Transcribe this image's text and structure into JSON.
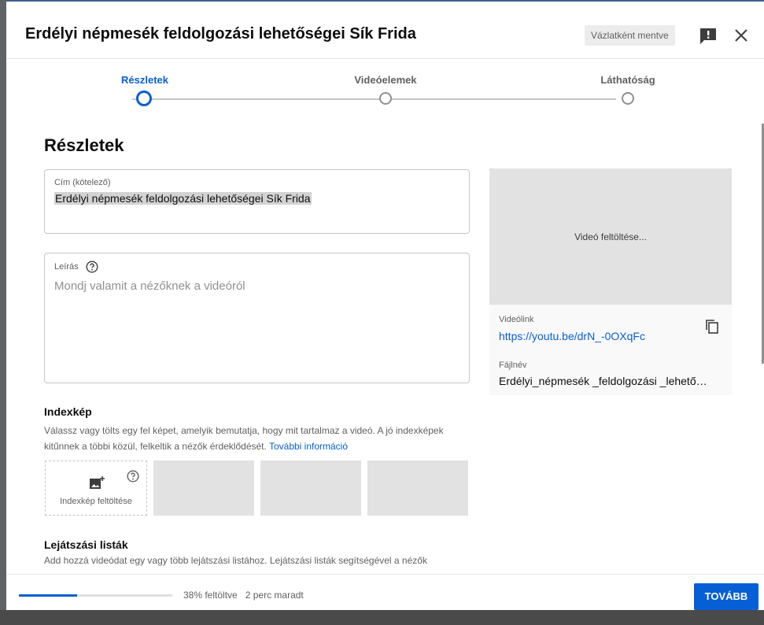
{
  "dialog": {
    "title": "Erdélyi népmesék feldolgozási lehetőségei Sík Frida",
    "draft_badge": "Vázlatként mentve"
  },
  "stepper": {
    "steps": [
      {
        "label": "Részletek",
        "active": true
      },
      {
        "label": "Videóelemek",
        "active": false
      },
      {
        "label": "Láthatóság",
        "active": false
      }
    ]
  },
  "details": {
    "section_title": "Részletek",
    "title_field": {
      "label": "Cím (kötelező)",
      "value": "Erdélyi népmesék  feldolgozási  lehetőségei Sík Frida"
    },
    "description_field": {
      "label": "Leírás",
      "placeholder": "Mondj valamit a nézőknek a videóról"
    }
  },
  "preview": {
    "status": "Videó feltöltése...",
    "video_link_label": "Videólink",
    "video_link": "https://youtu.be/drN_-0OXqFc",
    "filename_label": "Fájlnév",
    "filename": "Erdélyi_népmesék _feldolgozási _lehető…"
  },
  "thumbnail": {
    "title": "Indexkép",
    "description": "Válassz vagy tölts egy fel képet, amelyik bemutatja, hogy mit tartalmaz a videó. A jó indexképek kitűnnek a többi közül, felkeltik a nézők érdeklődését.",
    "more_link": "További információ",
    "upload_label": "Indexkép feltöltése"
  },
  "playlists": {
    "title": "Lejátszási listák",
    "description": "Add hozzá videódat egy vagy több lejátszási listához. Lejátszási listák segítségével a nézők"
  },
  "footer": {
    "progress_fraction": 0.38,
    "progress_text": "38% feltöltve",
    "time_left": "2 perc maradt",
    "next_label": "TOVÁBB"
  },
  "colors": {
    "accent": "#065fd4",
    "draft_badge_bg": "#ececec",
    "placeholder_tile": "#e2e2e2"
  }
}
